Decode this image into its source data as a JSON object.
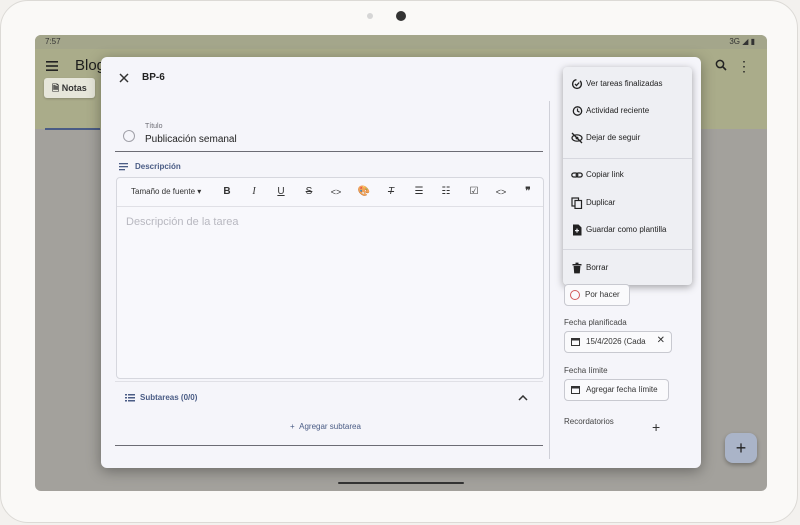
{
  "status_bar": {
    "time": "7:57",
    "network": "3G"
  },
  "app": {
    "title": "Blog",
    "notes_chip": "Notas"
  },
  "dialog": {
    "task_id": "BP-6",
    "title_label": "Título",
    "title_value": "Publicación semanal",
    "description_label": "Descripción",
    "font_size_label": "Tamaño de fuente",
    "description_placeholder": "Descripción de la tarea",
    "subtasks_label": "Subtareas (0/0)",
    "add_subtask_label": "Agregar subtarea"
  },
  "context_menu": {
    "items": [
      {
        "label": "Ver tareas finalizadas",
        "icon": "check-loop-icon"
      },
      {
        "label": "Actividad reciente",
        "icon": "history-icon"
      },
      {
        "label": "Dejar de seguir",
        "icon": "eye-off-icon"
      },
      {
        "label": "Copiar link",
        "icon": "link-icon"
      },
      {
        "label": "Duplicar",
        "icon": "copy-icon"
      },
      {
        "label": "Guardar como plantilla",
        "icon": "template-icon"
      },
      {
        "label": "Borrar",
        "icon": "trash-icon"
      }
    ]
  },
  "sidebar": {
    "status_label": "Por hacer",
    "planned_date_label": "Fecha planificada",
    "planned_date_value": "15/4/2026 (Cada",
    "due_date_label": "Fecha límite",
    "add_due_date_label": "Agregar fecha límite",
    "reminders_label": "Recordatorios"
  },
  "colors": {
    "accent": "#4a5c85",
    "status_todo": "#d15959"
  }
}
